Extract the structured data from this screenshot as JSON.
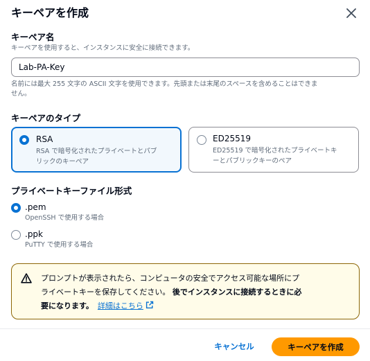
{
  "modal": {
    "title": "キーペアを作成"
  },
  "key_name": {
    "label": "キーペア名",
    "description": "キーペアを使用すると、インスタンスに安全に接続できます。",
    "value": "Lab-PA-Key",
    "constraint_line1": "名前には最大 255 文字の ASCII 文字を使用できます。先頭または末尾のスペースを含めることはできま",
    "constraint_line2": "せん。"
  },
  "key_type": {
    "label": "キーペアのタイプ",
    "options": [
      {
        "title": "RSA",
        "desc_line1": "RSA で暗号化されたプライベートとパブ",
        "desc_line2": "リックのキーペア",
        "selected": true
      },
      {
        "title": "ED25519",
        "desc_line1": "ED25519 で暗号化されたプライベートキ",
        "desc_line2": "ーとパブリックキーのペア",
        "selected": false
      }
    ]
  },
  "file_format": {
    "label": "プライベートキーファイル形式",
    "options": [
      {
        "title": ".pem",
        "desc": "OpenSSH で使用する場合",
        "selected": true
      },
      {
        "title": ".ppk",
        "desc": "PuTTY で使用する場合",
        "selected": false
      }
    ]
  },
  "alert": {
    "line1": "プロンプトが表示されたら、コンピュータの安全でアクセス可能な場所にプ",
    "line2_plain": "ライベートキーを保存してください。",
    "line2_bold": "後でインスタンスに接続するときに必",
    "line3_bold": "要になります。",
    "link": "詳細はこちら"
  },
  "footer": {
    "cancel_label": "キャンセル",
    "create_label": "キーペアを作成"
  },
  "colors": {
    "accent": "#0972d3",
    "primary_button": "#ff9900",
    "warning_border": "#8d6605",
    "warning_bg": "#fffce9"
  },
  "icons": [
    "close-icon",
    "warning-icon",
    "external-link-icon"
  ]
}
